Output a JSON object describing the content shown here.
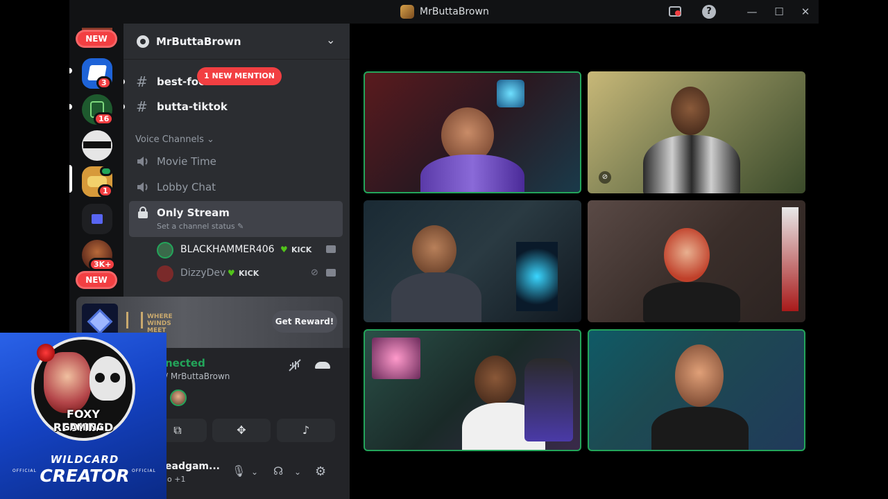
{
  "window": {
    "title": "MrButtaBrown"
  },
  "server_rail": {
    "top_new_label": "NEW",
    "bottom_new_label": "NEW",
    "servers": [
      {
        "name": "blue-w-server",
        "badge": "3",
        "color": "#1e63d8"
      },
      {
        "name": "foxhole-server",
        "badge": "16",
        "color": "#1e5a2e"
      },
      {
        "name": "ninja-server",
        "badge": "",
        "color": "#dcdcdc"
      },
      {
        "name": "mrbuttabrown-server",
        "badge": "1",
        "color": "#d79a3a"
      },
      {
        "name": "folder",
        "badge": "",
        "color": "#1f2a55"
      },
      {
        "name": "bearded-server",
        "badge": "3K+",
        "color": "#6a2a1a"
      }
    ]
  },
  "channel_panel": {
    "server_name": "MrButtaBrown",
    "mention_pill": "1 NEW MENTION",
    "text_channels": [
      {
        "name": "best-food-spot-ing",
        "display": "best-foo"
      },
      {
        "name": "butta-tiktok",
        "display": "butta-tiktok"
      }
    ],
    "voice_category": "Voice Channels",
    "voice_channels": [
      {
        "name": "Movie Time"
      },
      {
        "name": "Lobby Chat"
      },
      {
        "name": "Only Stream",
        "status": "Set a channel status"
      }
    ],
    "voice_users": [
      {
        "name": "BLACKHAMMER406",
        "tag": "KICK",
        "color": "#f2f3f5"
      },
      {
        "name": "DizzyDev",
        "tag": "KICK",
        "color": "#949ba4"
      }
    ]
  },
  "promo": {
    "brand": "WHERE WINDS MEET",
    "button": "Get Reward!"
  },
  "voice_connected": {
    "status": "nected",
    "channel": "/ MrButtaBrown"
  },
  "user_bar": {
    "name": "eadgam...",
    "sub": "io +1"
  },
  "overlay": {
    "title": "FOXY REDHEAD",
    "subtitle": "GAMING",
    "wild": "WILDCARD",
    "creator": "CREATOR",
    "official": "OFFICIAL"
  },
  "video_tiles": [
    {
      "id": "tile-1",
      "speaking": true,
      "bg": "#4a1d22"
    },
    {
      "id": "tile-2",
      "speaking": false,
      "bg": "#8a8a5a"
    },
    {
      "id": "tile-3",
      "speaking": false,
      "bg": "#23313a"
    },
    {
      "id": "tile-4",
      "speaking": false,
      "bg": "#4a3a36"
    },
    {
      "id": "tile-5",
      "speaking": true,
      "bg": "#2a4038"
    },
    {
      "id": "tile-6",
      "speaking": true,
      "bg": "#1d4a52"
    }
  ]
}
